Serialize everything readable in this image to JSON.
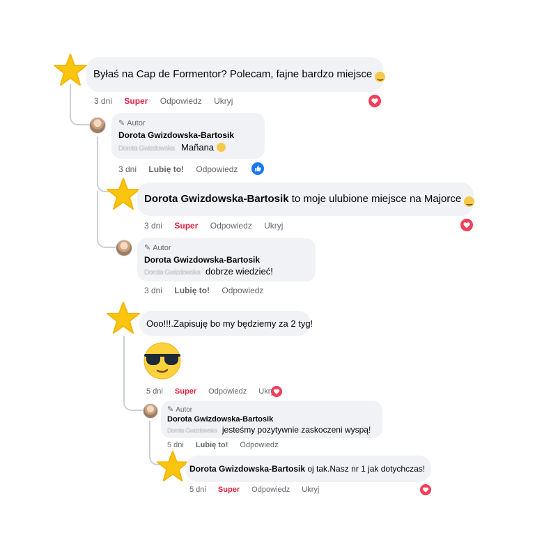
{
  "comments": [
    {
      "text": "Byłaś na Cap de Formentor? Polecam, fajne bardzo miejsce",
      "time": "3 dni",
      "react": "Super",
      "reply": "Odpowiedz",
      "hide": "Ukryj",
      "reaction_icon": "love-heart-icon",
      "avatar_icon": "star-icon"
    },
    {
      "author_badge": "Autor",
      "name": "Dorota Gwizdowska-Bartosik",
      "blurred": "Dorota Gwizdowska",
      "text": "Mañana",
      "time": "3 dni",
      "react": "Lubię to!",
      "reply": "Odpowiedz",
      "reaction_icon": "like-thumb-icon"
    },
    {
      "name": "Dorota Gwizdowska-Bartosik",
      "text": "to moje ulubione miejsce na Majorce",
      "time": "3 dni",
      "react": "Super",
      "reply": "Odpowiedz",
      "hide": "Ukryj",
      "reaction_icon": "love-heart-icon",
      "avatar_icon": "star-icon"
    },
    {
      "author_badge": "Autor",
      "name": "Dorota Gwizdowska-Bartosik",
      "blurred": "Dorota Gwizdowska",
      "text": "dobrze wiedzieć!",
      "time": "3 dni",
      "react": "Lubię to!",
      "reply": "Odpowiedz"
    },
    {
      "text": "Ooo!!!.Zapisuję bo my będziemy za 2 tyg!",
      "sticker": "sunglasses-emoji",
      "time": "5 dni",
      "react": "Super",
      "reply": "Odpowiedz",
      "hide": "Ukryj",
      "reaction_icon": "love-heart-icon",
      "avatar_icon": "star-icon"
    },
    {
      "author_badge": "Autor",
      "name": "Dorota Gwizdowska-Bartosik",
      "blurred": "Dorota Gwizdowska",
      "text": "jesteśmy pozytywnie zaskoczeni wyspą!",
      "time": "5 dni",
      "react": "Lubię to!",
      "reply": "Odpowiedz"
    },
    {
      "name": "Dorota Gwizdowska-Bartosik",
      "text": "oj tak.Nasz nr 1 jak dotychczas!",
      "time": "5 dni",
      "react": "Super",
      "reply": "Odpowiedz",
      "hide": "Ukryj",
      "reaction_icon": "love-heart-icon",
      "avatar_icon": "star-icon"
    }
  ],
  "colors": {
    "bubble": "#f0f2f5",
    "super": "#e41e3f",
    "like_blue": "#1877f2",
    "meta": "#65676b",
    "star": "#f9c50e"
  }
}
